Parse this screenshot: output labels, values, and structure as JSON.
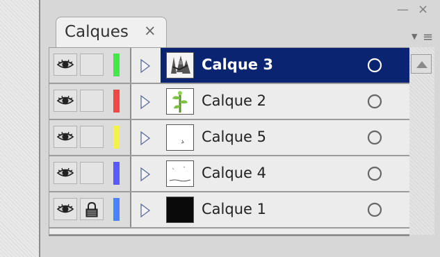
{
  "panel": {
    "tab_label": "Calques",
    "tab_close": "×",
    "minimize_glyph": "—",
    "close_glyph": "×",
    "menu_arrow_glyph": "▼",
    "menu_lines_glyph": "≡"
  },
  "layers": [
    {
      "name": "Calque 3",
      "color": "#44e844",
      "visible": true,
      "locked": false,
      "selected": true,
      "thumbnail": "trees-grayscale"
    },
    {
      "name": "Calque 2",
      "color": "#f04848",
      "visible": true,
      "locked": false,
      "selected": false,
      "thumbnail": "green-plant"
    },
    {
      "name": "Calque 5",
      "color": "#f2f24a",
      "visible": true,
      "locked": false,
      "selected": false,
      "thumbnail": "small-mark"
    },
    {
      "name": "Calque 4",
      "color": "#5a5aff",
      "visible": true,
      "locked": false,
      "selected": false,
      "thumbnail": "sketch-line"
    },
    {
      "name": "Calque 1",
      "color": "#4a82ff",
      "visible": true,
      "locked": true,
      "selected": false,
      "thumbnail": "black-fill"
    }
  ],
  "icons": {
    "visibility": "eye-icon",
    "lock": "lock-icon",
    "expand": "triangle-right-icon",
    "target": "circle-icon",
    "scroll_up": "triangle-up-icon",
    "panel_menu": "menu-icon"
  }
}
